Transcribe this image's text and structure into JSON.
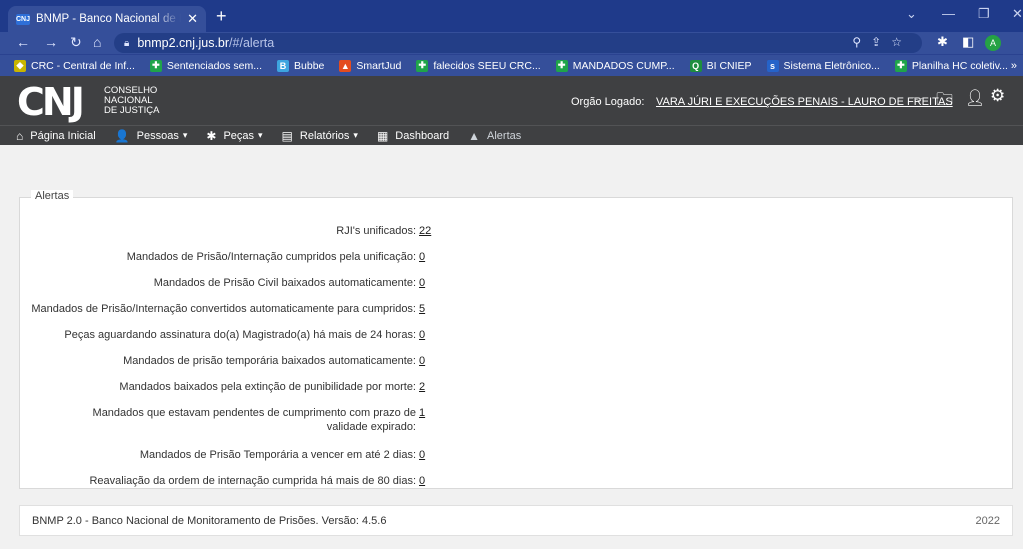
{
  "browser": {
    "tab_title": "BNMP - Banco Nacional de Mand",
    "tab_favicon": "CNJ",
    "url_host": "bnmp2.cnj.jus.br",
    "url_path": "/#/alerta",
    "avatar_letter": "A",
    "bookmarks": [
      {
        "label": "CRC - Central de Inf...",
        "icon": "crc-icon",
        "color": "#c8b400",
        "glyph": "◆"
      },
      {
        "label": "Sentenciados sem...",
        "icon": "cross-icon",
        "color": "#1fa44a",
        "glyph": "✚"
      },
      {
        "label": "Bubbe",
        "icon": "bubbe-icon",
        "color": "#3da5e0",
        "glyph": "B"
      },
      {
        "label": "SmartJud",
        "icon": "smartjud-icon",
        "color": "#e44c1f",
        "glyph": "▲"
      },
      {
        "label": "falecidos SEEU CRC...",
        "icon": "cross-icon",
        "color": "#1fa44a",
        "glyph": "✚"
      },
      {
        "label": "MANDADOS CUMP...",
        "icon": "cross-icon",
        "color": "#1fa44a",
        "glyph": "✚"
      },
      {
        "label": "BI CNIEP",
        "icon": "sheets-icon",
        "color": "#1e8e3e",
        "glyph": "Q"
      },
      {
        "label": "Sistema Eletrônico...",
        "icon": "seu-icon",
        "color": "#2563c9",
        "glyph": "s"
      },
      {
        "label": "Planilha HC coletiv...",
        "icon": "cross-icon",
        "color": "#1fa44a",
        "glyph": "✚"
      }
    ]
  },
  "header": {
    "logo_mark": "CNJ",
    "logo_line1": "CONSELHO",
    "logo_line2": "NACIONAL",
    "logo_line3": "DE JUSTIÇA",
    "orgao_label": "Orgão Logado:",
    "orgao_value": "VARA JÚRI E EXECUÇÕES PENAIS - LAURO DE FREITAS"
  },
  "menu": [
    {
      "label": "Página Inicial",
      "icon": "home-icon",
      "glyph": "⌂",
      "caret": false
    },
    {
      "label": "Pessoas",
      "icon": "person-icon",
      "glyph": "👤",
      "caret": true
    },
    {
      "label": "Peças",
      "icon": "puzzle-icon",
      "glyph": "✱",
      "caret": true
    },
    {
      "label": "Relatórios",
      "icon": "document-icon",
      "glyph": "▤",
      "caret": true
    },
    {
      "label": "Dashboard",
      "icon": "dashboard-icon",
      "glyph": "▦",
      "caret": false
    },
    {
      "label": "Alertas",
      "icon": "warning-icon",
      "glyph": "▲",
      "caret": false
    }
  ],
  "alerts": {
    "legend": "Alertas",
    "items": [
      {
        "label": "RJI's unificados:",
        "value": "22"
      },
      {
        "label": "Mandados de Prisão/Internação cumpridos pela unificação:",
        "value": "0"
      },
      {
        "label": "Mandados de Prisão Civil baixados automaticamente:",
        "value": "0"
      },
      {
        "label": "Mandados de Prisão/Internação convertidos automaticamente para cumpridos:",
        "value": "5"
      },
      {
        "label": "Peças aguardando assinatura do(a) Magistrado(a) há mais de 24 horas:",
        "value": "0"
      },
      {
        "label": "Mandados de prisão temporária baixados automaticamente:",
        "value": "0"
      },
      {
        "label": "Mandados baixados pela extinção de punibilidade por morte:",
        "value": "2"
      },
      {
        "label": "Mandados que estavam pendentes de cumprimento com prazo de validade expirado:",
        "value": "1"
      },
      {
        "label": "Mandados de Prisão Temporária a vencer em até 2 dias:",
        "value": "0"
      },
      {
        "label": "Reavaliação da ordem de internação cumprida há mais de 80 dias:",
        "value": "0"
      }
    ]
  },
  "footer": {
    "text": "BNMP 2.0 - Banco Nacional de Monitoramento de Prisões. Versão: 4.5.6",
    "year": "2022"
  }
}
